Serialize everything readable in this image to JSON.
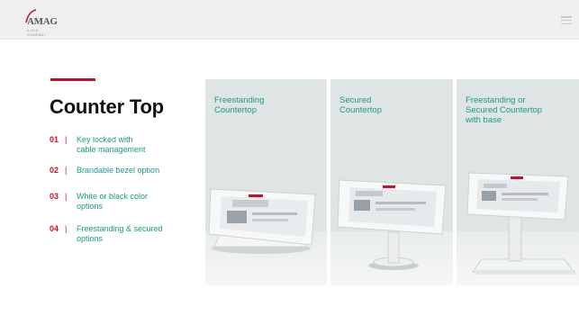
{
  "header": {
    "logo_text": "AMAG",
    "logo_sub": "A G4S COMPANY"
  },
  "main": {
    "title": "Counter Top",
    "features": [
      {
        "num": "01",
        "sep": "|",
        "text_lines": [
          "Key locked with",
          "cable management"
        ]
      },
      {
        "num": "02",
        "sep": "|",
        "text_lines": [
          "Brandable bezel option"
        ]
      },
      {
        "num": "03",
        "sep": "|",
        "text_lines": [
          "White or black color",
          "options"
        ]
      },
      {
        "num": "04",
        "sep": "|",
        "text_lines": [
          "Freestanding & secured",
          "options"
        ]
      }
    ],
    "products": [
      {
        "label_lines": [
          "Freestanding",
          "Countertop"
        ]
      },
      {
        "label_lines": [
          "Secured",
          "Countertop"
        ]
      },
      {
        "label_lines": [
          "Freestanding or",
          "Secured Countertop",
          "with base"
        ]
      }
    ]
  },
  "colors": {
    "accent_red": "#c8102e",
    "accent_teal": "#1a9c84",
    "header_bg": "#edeff0",
    "panel_bg": "#dfe4e4"
  }
}
